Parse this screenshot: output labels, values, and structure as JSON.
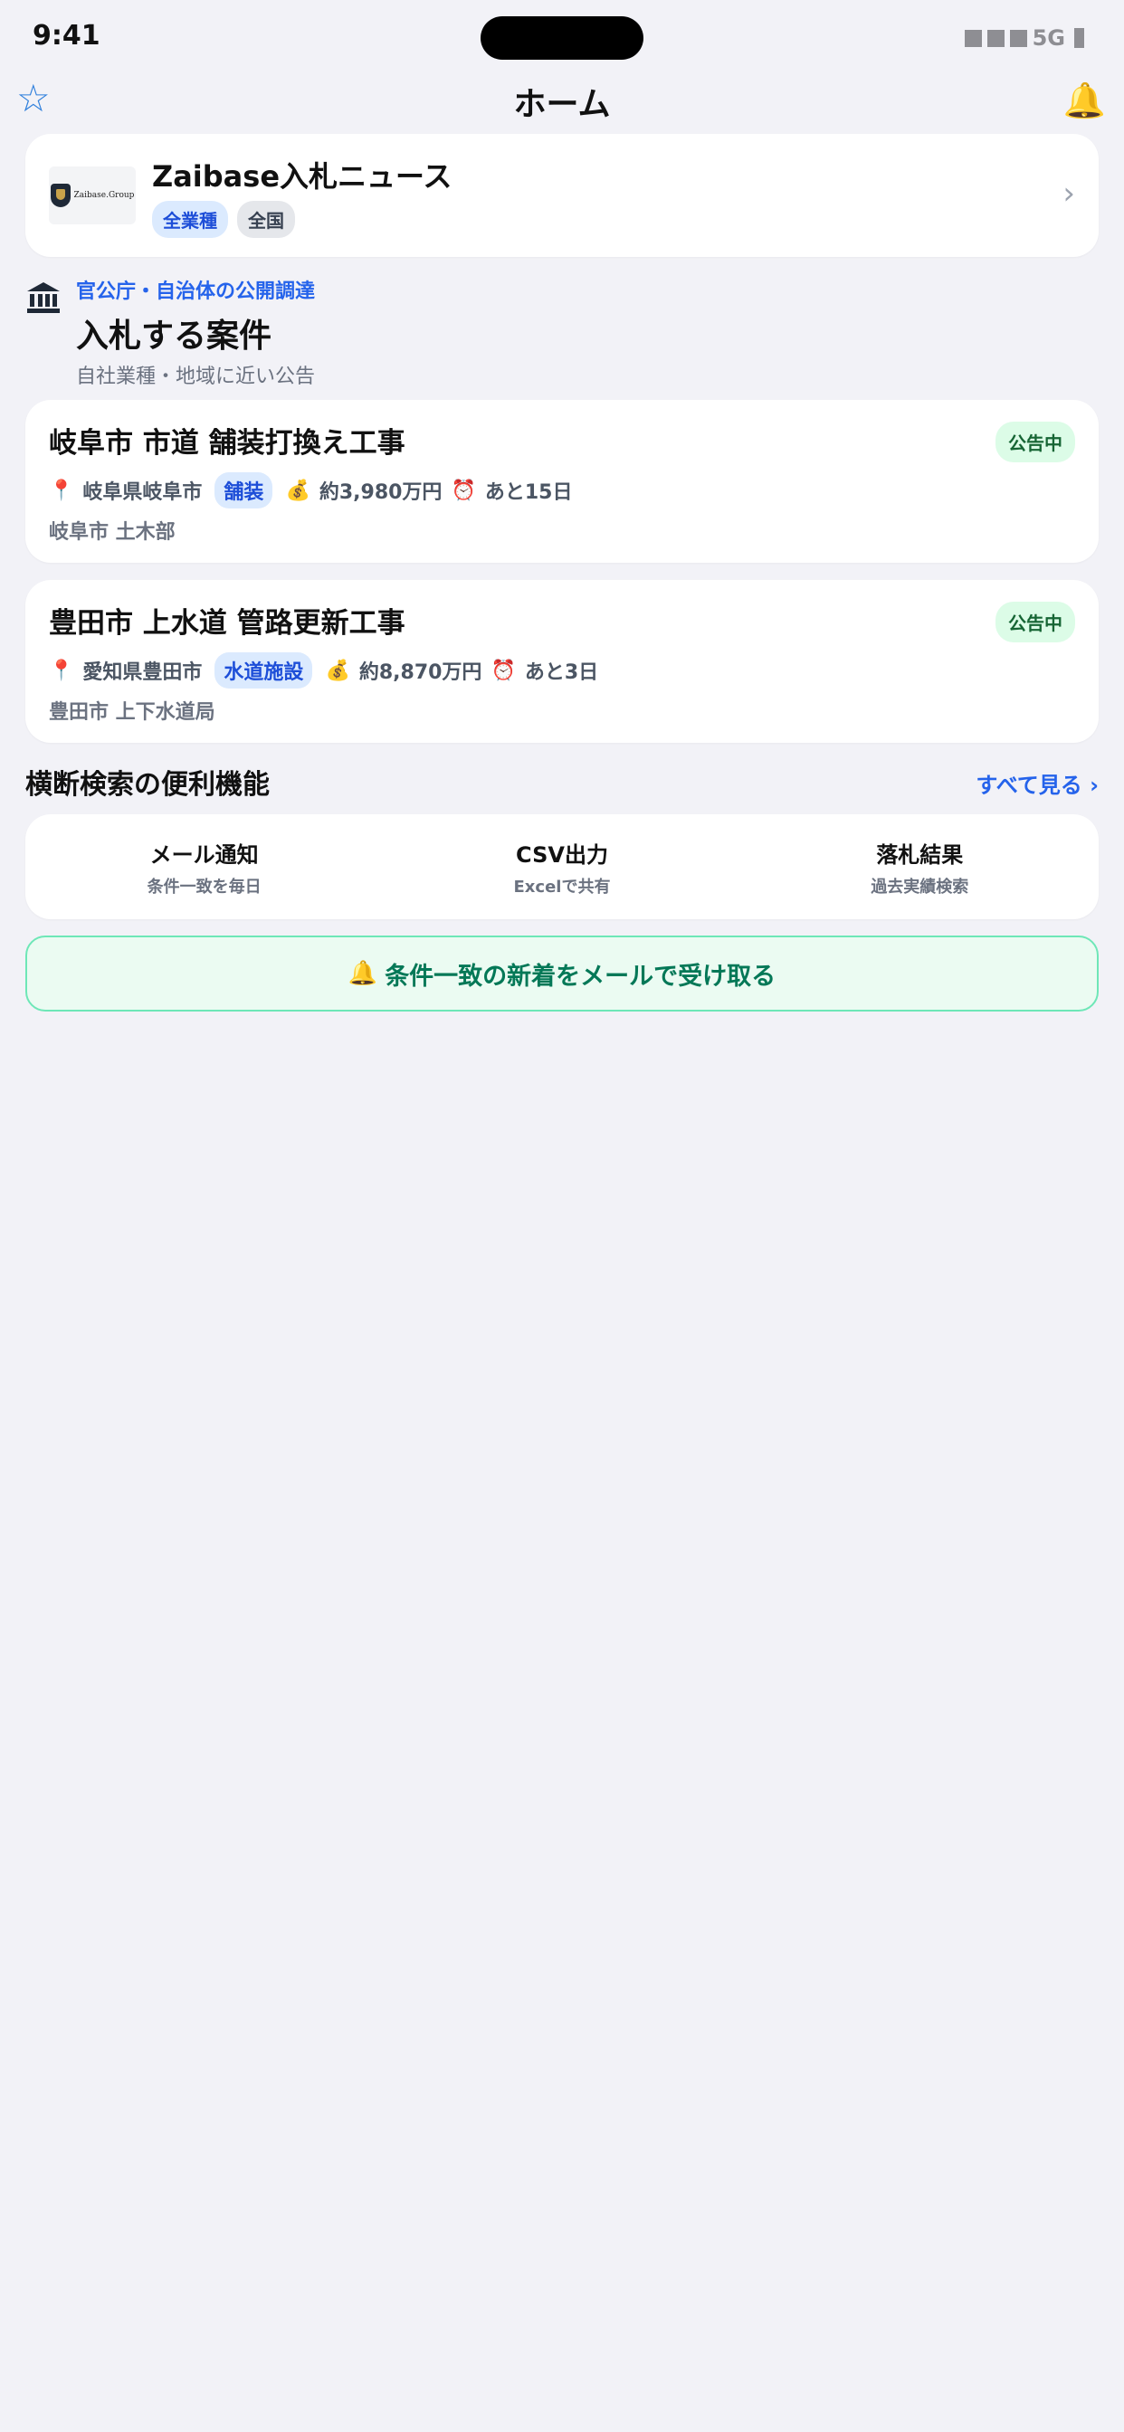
{
  "status_bar": {
    "time": "9:41",
    "network": "5G"
  },
  "nav": {
    "title": "ホーム",
    "favorite_icon": "star-icon",
    "notification_icon": "bell-icon"
  },
  "source": {
    "logo_text": "Zaibase.Group",
    "title": "Zaibase入札ニュース",
    "tags": [
      "全業種",
      "全国"
    ]
  },
  "section": {
    "kicker": "官公庁・自治体の公開調達",
    "title": "入札する案件",
    "subtitle": "自社業種・地域に近い公告"
  },
  "tenders": [
    {
      "title": "岐阜市 市道 舗装打換え工事",
      "status": "公告中",
      "location": "岐阜県岐阜市",
      "category": "舗装",
      "amount": "約3,980万円",
      "deadline": "あと15日",
      "org": "岐阜市 土木部"
    },
    {
      "title": "豊田市 上水道 管路更新工事",
      "status": "公告中",
      "location": "愛知県豊田市",
      "category": "水道施設",
      "amount": "約8,870万円",
      "deadline": "あと3日",
      "org": "豊田市 上下水道局"
    }
  ],
  "features": {
    "title": "横断検索の便利機能",
    "see_all": "すべて見る ›",
    "items": [
      {
        "label": "メール通知",
        "sub": "条件一致を毎日"
      },
      {
        "label": "CSV出力",
        "sub": "Excelで共有"
      },
      {
        "label": "落札結果",
        "sub": "過去実績検索"
      }
    ]
  },
  "cta": {
    "label": "条件一致の新着をメールで受け取る"
  },
  "colors": {
    "accent": "#2563eb",
    "success": "#047857",
    "background": "#f2f2f7"
  }
}
